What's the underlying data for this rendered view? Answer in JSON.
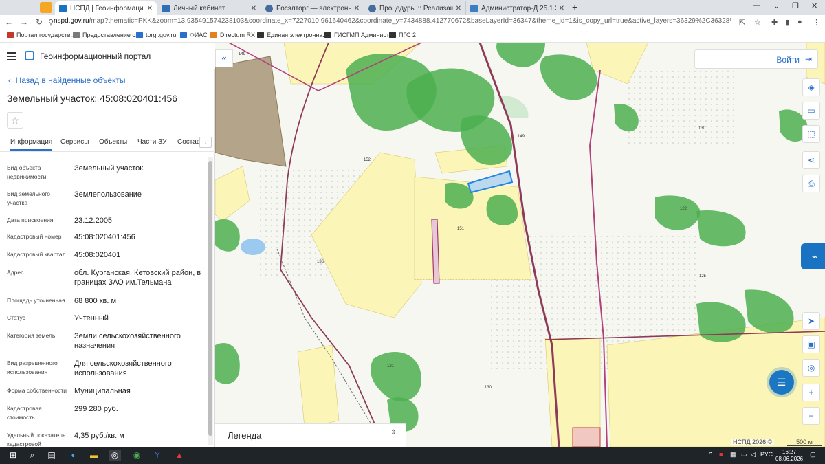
{
  "browser": {
    "tabs": [
      {
        "title": "НСПД | Геоинформационный п",
        "active": true,
        "fav_color": "#1a73c2"
      },
      {
        "title": "Личный кабинет",
        "active": false,
        "fav_color": "#2f6fb5"
      },
      {
        "title": "Росэлторг — электронная торг",
        "active": false,
        "fav_color": "#456c9c"
      },
      {
        "title": "Процедуры :: Реализация госи",
        "active": false,
        "fav_color": "#456c9c"
      },
      {
        "title": "Администратор-Д 25.1.350.417",
        "active": false,
        "fav_color": "#3a7fc0"
      }
    ],
    "url_host": "nspd.gov.ru",
    "url_rest": "/map?thematic=PKK&zoom=13.935491574238103&coordinate_x=7227010.961640462&coordinate_y=7434888.412770672&baseLayerId=36347&theme_id=1&is_copy_url=true&active_layers=36329%2C36328%2C36049%2C36473%2C3729...",
    "bookmarks": [
      {
        "label": "Портал государств...",
        "color": "#c0392b"
      },
      {
        "label": "Предоставление с...",
        "color": "#7a7a7a"
      },
      {
        "label": "torgi.gov.ru",
        "color": "#2a6fc9"
      },
      {
        "label": "ФИАС",
        "color": "#2a6fc9"
      },
      {
        "label": "Directum RX",
        "color": "#e67e22"
      },
      {
        "label": "Единая электронна...",
        "color": "#333333"
      },
      {
        "label": "ГИСГМП Администр...",
        "color": "#333333"
      },
      {
        "label": "ПГС 2",
        "color": "#333333"
      }
    ]
  },
  "app": {
    "title": "Геоинформационный портал",
    "back_label": "Назад в найденные объекты",
    "object_title": "Земельный участок: 45:08:020401:456",
    "tabs": [
      "Информация",
      "Сервисы",
      "Объекты",
      "Части ЗУ",
      "Состав"
    ],
    "properties": [
      {
        "label": "Вид объекта недвижимости",
        "value": "Земельный участок"
      },
      {
        "label": "Вид земельного участка",
        "value": "Землепользование"
      },
      {
        "label": "Дата присвоения",
        "value": "23.12.2005"
      },
      {
        "label": "Кадастровый номер",
        "value": "45:08:020401:456"
      },
      {
        "label": "Кадастровый квартал",
        "value": "45:08:020401"
      },
      {
        "label": "Адрес",
        "value": "обл. Курганская, Кетовский район, в границах ЗАО им.Тельмана"
      },
      {
        "label": "Площадь уточненная",
        "value": "68 800 кв. м"
      },
      {
        "label": "Статус",
        "value": "Учтенный"
      },
      {
        "label": "Категория земель",
        "value": "Земли сельскохозяйственного назначения"
      },
      {
        "label": "Вид разрешенного использования",
        "value": "Для сельскохозяйственного использования"
      },
      {
        "label": "Форма собственности",
        "value": "Муниципальная"
      },
      {
        "label": "Кадастровая стоимость",
        "value": "299 280 руб."
      },
      {
        "label": "Удельный показатель кадастровой",
        "value": "4,35 руб./кв. м"
      }
    ]
  },
  "map": {
    "login_label": "Войти",
    "legend_label": "Легенда",
    "copyright": "НСПД 2026 ©",
    "scale": "500 м",
    "labels": [
      "149",
      "152",
      "136",
      "151",
      "121",
      "130",
      "130",
      "122",
      "125",
      "149"
    ]
  },
  "taskbar": {
    "lang": "РУС",
    "time": "16:27",
    "date": "08.06.2026"
  },
  "colors": {
    "accent": "#2a6fc9",
    "forest": "#4caf50",
    "field": "#fbf5b8",
    "selected_parcel": "#1e88e5",
    "boundary": "#8e3b5a"
  }
}
